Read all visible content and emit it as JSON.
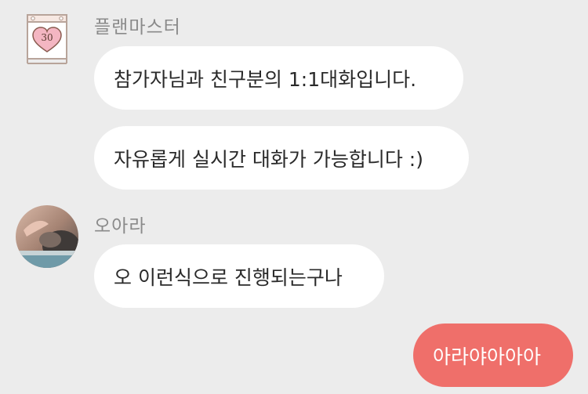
{
  "messages": [
    {
      "sender": "플랜마스터",
      "avatar": "calendar-heart-icon",
      "avatar_number": "30",
      "texts": [
        "참가자님과 친구분의 1:1대화입니다.",
        "자유롭게 실시간 대화가 가능합니다 :)"
      ]
    },
    {
      "sender": "오아라",
      "avatar": "cat-photo",
      "texts": [
        "오 이런식으로 진행되는구나"
      ]
    },
    {
      "sender": "me",
      "texts": [
        "아라야아아아"
      ]
    }
  ],
  "colors": {
    "background": "#ececec",
    "incoming_bubble": "#ffffff",
    "outgoing_bubble": "#ef6f6a",
    "sender_name": "#8a8a8a",
    "heart": "#f4b6c2"
  }
}
